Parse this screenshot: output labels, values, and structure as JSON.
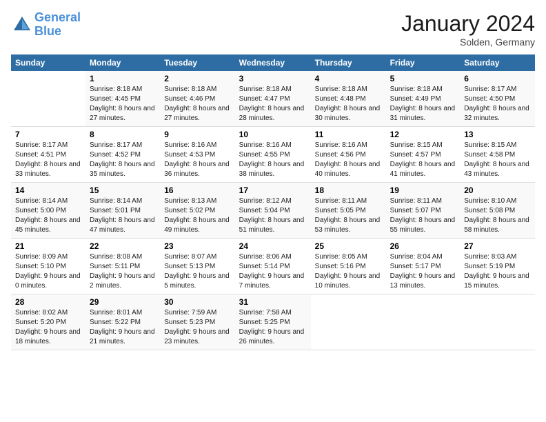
{
  "header": {
    "logo_line1": "General",
    "logo_line2": "Blue",
    "month": "January 2024",
    "location": "Solden, Germany"
  },
  "weekdays": [
    "Sunday",
    "Monday",
    "Tuesday",
    "Wednesday",
    "Thursday",
    "Friday",
    "Saturday"
  ],
  "weeks": [
    [
      {
        "day": "",
        "sunrise": "",
        "sunset": "",
        "daylight": ""
      },
      {
        "day": "1",
        "sunrise": "Sunrise: 8:18 AM",
        "sunset": "Sunset: 4:45 PM",
        "daylight": "Daylight: 8 hours and 27 minutes."
      },
      {
        "day": "2",
        "sunrise": "Sunrise: 8:18 AM",
        "sunset": "Sunset: 4:46 PM",
        "daylight": "Daylight: 8 hours and 27 minutes."
      },
      {
        "day": "3",
        "sunrise": "Sunrise: 8:18 AM",
        "sunset": "Sunset: 4:47 PM",
        "daylight": "Daylight: 8 hours and 28 minutes."
      },
      {
        "day": "4",
        "sunrise": "Sunrise: 8:18 AM",
        "sunset": "Sunset: 4:48 PM",
        "daylight": "Daylight: 8 hours and 30 minutes."
      },
      {
        "day": "5",
        "sunrise": "Sunrise: 8:18 AM",
        "sunset": "Sunset: 4:49 PM",
        "daylight": "Daylight: 8 hours and 31 minutes."
      },
      {
        "day": "6",
        "sunrise": "Sunrise: 8:17 AM",
        "sunset": "Sunset: 4:50 PM",
        "daylight": "Daylight: 8 hours and 32 minutes."
      }
    ],
    [
      {
        "day": "7",
        "sunrise": "Sunrise: 8:17 AM",
        "sunset": "Sunset: 4:51 PM",
        "daylight": "Daylight: 8 hours and 33 minutes."
      },
      {
        "day": "8",
        "sunrise": "Sunrise: 8:17 AM",
        "sunset": "Sunset: 4:52 PM",
        "daylight": "Daylight: 8 hours and 35 minutes."
      },
      {
        "day": "9",
        "sunrise": "Sunrise: 8:16 AM",
        "sunset": "Sunset: 4:53 PM",
        "daylight": "Daylight: 8 hours and 36 minutes."
      },
      {
        "day": "10",
        "sunrise": "Sunrise: 8:16 AM",
        "sunset": "Sunset: 4:55 PM",
        "daylight": "Daylight: 8 hours and 38 minutes."
      },
      {
        "day": "11",
        "sunrise": "Sunrise: 8:16 AM",
        "sunset": "Sunset: 4:56 PM",
        "daylight": "Daylight: 8 hours and 40 minutes."
      },
      {
        "day": "12",
        "sunrise": "Sunrise: 8:15 AM",
        "sunset": "Sunset: 4:57 PM",
        "daylight": "Daylight: 8 hours and 41 minutes."
      },
      {
        "day": "13",
        "sunrise": "Sunrise: 8:15 AM",
        "sunset": "Sunset: 4:58 PM",
        "daylight": "Daylight: 8 hours and 43 minutes."
      }
    ],
    [
      {
        "day": "14",
        "sunrise": "Sunrise: 8:14 AM",
        "sunset": "Sunset: 5:00 PM",
        "daylight": "Daylight: 8 hours and 45 minutes."
      },
      {
        "day": "15",
        "sunrise": "Sunrise: 8:14 AM",
        "sunset": "Sunset: 5:01 PM",
        "daylight": "Daylight: 8 hours and 47 minutes."
      },
      {
        "day": "16",
        "sunrise": "Sunrise: 8:13 AM",
        "sunset": "Sunset: 5:02 PM",
        "daylight": "Daylight: 8 hours and 49 minutes."
      },
      {
        "day": "17",
        "sunrise": "Sunrise: 8:12 AM",
        "sunset": "Sunset: 5:04 PM",
        "daylight": "Daylight: 8 hours and 51 minutes."
      },
      {
        "day": "18",
        "sunrise": "Sunrise: 8:11 AM",
        "sunset": "Sunset: 5:05 PM",
        "daylight": "Daylight: 8 hours and 53 minutes."
      },
      {
        "day": "19",
        "sunrise": "Sunrise: 8:11 AM",
        "sunset": "Sunset: 5:07 PM",
        "daylight": "Daylight: 8 hours and 55 minutes."
      },
      {
        "day": "20",
        "sunrise": "Sunrise: 8:10 AM",
        "sunset": "Sunset: 5:08 PM",
        "daylight": "Daylight: 8 hours and 58 minutes."
      }
    ],
    [
      {
        "day": "21",
        "sunrise": "Sunrise: 8:09 AM",
        "sunset": "Sunset: 5:10 PM",
        "daylight": "Daylight: 9 hours and 0 minutes."
      },
      {
        "day": "22",
        "sunrise": "Sunrise: 8:08 AM",
        "sunset": "Sunset: 5:11 PM",
        "daylight": "Daylight: 9 hours and 2 minutes."
      },
      {
        "day": "23",
        "sunrise": "Sunrise: 8:07 AM",
        "sunset": "Sunset: 5:13 PM",
        "daylight": "Daylight: 9 hours and 5 minutes."
      },
      {
        "day": "24",
        "sunrise": "Sunrise: 8:06 AM",
        "sunset": "Sunset: 5:14 PM",
        "daylight": "Daylight: 9 hours and 7 minutes."
      },
      {
        "day": "25",
        "sunrise": "Sunrise: 8:05 AM",
        "sunset": "Sunset: 5:16 PM",
        "daylight": "Daylight: 9 hours and 10 minutes."
      },
      {
        "day": "26",
        "sunrise": "Sunrise: 8:04 AM",
        "sunset": "Sunset: 5:17 PM",
        "daylight": "Daylight: 9 hours and 13 minutes."
      },
      {
        "day": "27",
        "sunrise": "Sunrise: 8:03 AM",
        "sunset": "Sunset: 5:19 PM",
        "daylight": "Daylight: 9 hours and 15 minutes."
      }
    ],
    [
      {
        "day": "28",
        "sunrise": "Sunrise: 8:02 AM",
        "sunset": "Sunset: 5:20 PM",
        "daylight": "Daylight: 9 hours and 18 minutes."
      },
      {
        "day": "29",
        "sunrise": "Sunrise: 8:01 AM",
        "sunset": "Sunset: 5:22 PM",
        "daylight": "Daylight: 9 hours and 21 minutes."
      },
      {
        "day": "30",
        "sunrise": "Sunrise: 7:59 AM",
        "sunset": "Sunset: 5:23 PM",
        "daylight": "Daylight: 9 hours and 23 minutes."
      },
      {
        "day": "31",
        "sunrise": "Sunrise: 7:58 AM",
        "sunset": "Sunset: 5:25 PM",
        "daylight": "Daylight: 9 hours and 26 minutes."
      },
      {
        "day": "",
        "sunrise": "",
        "sunset": "",
        "daylight": ""
      },
      {
        "day": "",
        "sunrise": "",
        "sunset": "",
        "daylight": ""
      },
      {
        "day": "",
        "sunrise": "",
        "sunset": "",
        "daylight": ""
      }
    ]
  ]
}
